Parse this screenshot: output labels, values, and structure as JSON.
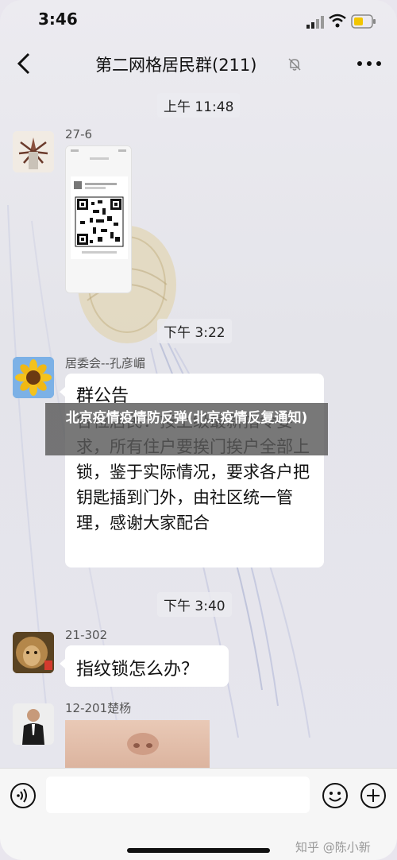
{
  "status_bar": {
    "time": "3:46"
  },
  "header": {
    "title": "第二网格居民群(211)"
  },
  "messages": {
    "timestamps": [
      "上午 11:48",
      "下午 3:22",
      "下午 3:40"
    ],
    "m1": {
      "sender": "27-6"
    },
    "m2": {
      "sender": "居委会--孔彦嵋",
      "title": "群公告",
      "body": "各位居民：按上级最新指令要求，所有住户要挨门挨户全部上锁，鉴于实际情况，要求各户把钥匙插到门外，由社区统一管理，感谢大家配合"
    },
    "m3": {
      "sender": "21-302",
      "text": "指纹锁怎么办？"
    },
    "m4": {
      "sender": "12-201楚杨"
    }
  },
  "overlay": {
    "headline": "北京疫情疫情防反弹(北京疫情反复通知)"
  },
  "watermark": {
    "text": "知乎 @陈小新"
  },
  "icons": {
    "back": "chevron-left-icon",
    "mute": "bell-muted-icon",
    "more": "more-dots-icon",
    "voice": "voice-icon",
    "emoji": "emoji-icon",
    "plus": "plus-icon"
  }
}
